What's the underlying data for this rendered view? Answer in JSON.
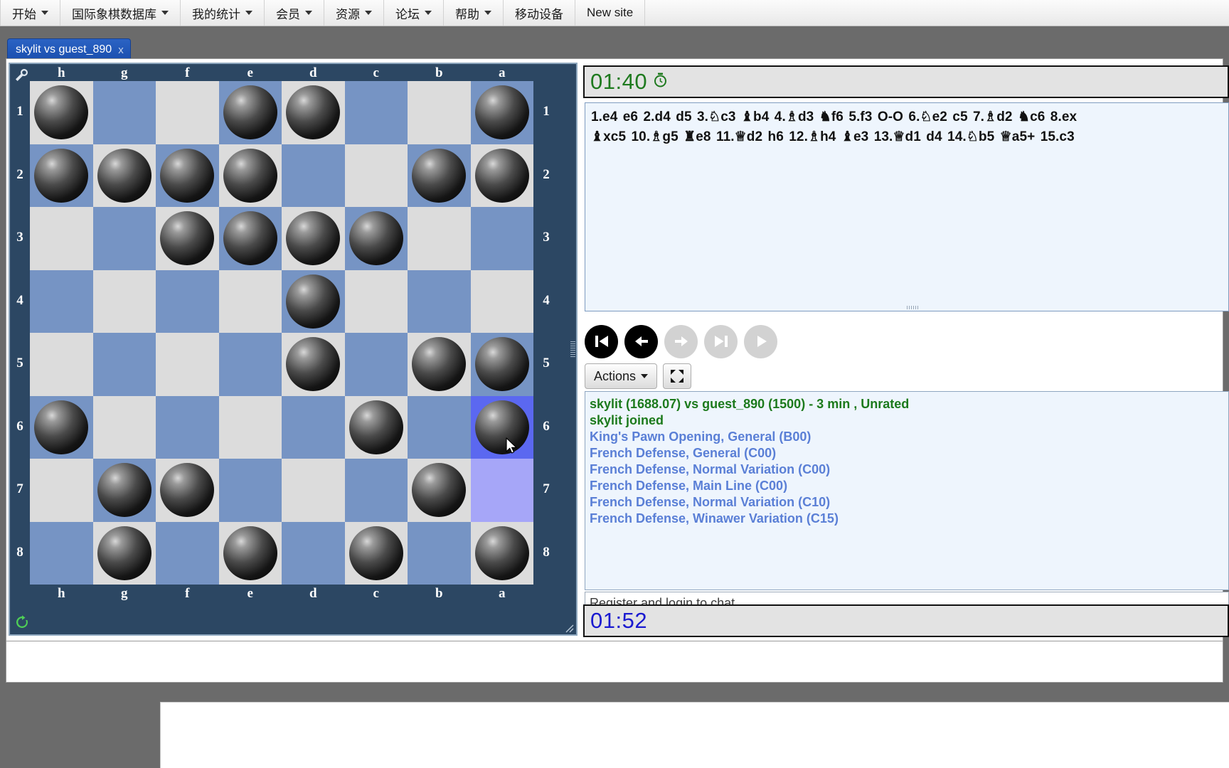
{
  "menubar": {
    "items": [
      {
        "label": "开始",
        "caret": true
      },
      {
        "label": "国际象棋数据库",
        "caret": true
      },
      {
        "label": "我的统计",
        "caret": true
      },
      {
        "label": "会员",
        "caret": true
      },
      {
        "label": "资源",
        "caret": true
      },
      {
        "label": "论坛",
        "caret": true
      },
      {
        "label": "帮助",
        "caret": true
      },
      {
        "label": "移动设备",
        "caret": false
      },
      {
        "label": "New site",
        "caret": false
      }
    ]
  },
  "tab": {
    "label": "skylit vs guest_890",
    "close": "x"
  },
  "board": {
    "files_top": [
      "h",
      "g",
      "f",
      "e",
      "d",
      "c",
      "b",
      "a"
    ],
    "files_bottom": [
      "h",
      "g",
      "f",
      "e",
      "d",
      "c",
      "b",
      "a"
    ],
    "ranks_left": [
      "1",
      "2",
      "3",
      "4",
      "5",
      "6",
      "7",
      "8"
    ],
    "ranks_right": [
      "1",
      "2",
      "3",
      "4",
      "5",
      "6",
      "7",
      "8"
    ],
    "tool_icon": "wrench-icon",
    "refresh_icon": "refresh-icon",
    "resize_icon": "resize-grip-icon",
    "highlight_from": "a7",
    "highlight_to": "a6",
    "orientation": "black-bottom-flipped",
    "piece_rows": [
      [
        1,
        0,
        0,
        1,
        1,
        0,
        0,
        1
      ],
      [
        1,
        1,
        1,
        1,
        0,
        0,
        1,
        1
      ],
      [
        0,
        0,
        1,
        1,
        1,
        1,
        0,
        0
      ],
      [
        0,
        0,
        0,
        0,
        1,
        0,
        0,
        0
      ],
      [
        0,
        0,
        0,
        0,
        1,
        0,
        1,
        1
      ],
      [
        1,
        0,
        0,
        0,
        0,
        1,
        0,
        1
      ],
      [
        0,
        1,
        1,
        0,
        0,
        0,
        1,
        0
      ],
      [
        0,
        1,
        0,
        1,
        0,
        1,
        0,
        1
      ]
    ]
  },
  "clocks": {
    "top": {
      "time": "01:40",
      "icon": "stopwatch-icon",
      "color": "#1f7a1f"
    },
    "bottom": {
      "time": "01:52",
      "icon": "none",
      "color": "#1a1ad0"
    }
  },
  "moves": {
    "text": "1.e4 e6 2.d4 d5 3.♘c3 ♝b4 4.♗d3 ♞f6 5.f3 O-O 6.♘e2 c5 7.♗d2 ♞c6 8.ex ♝xc5 10.♗g5 ♜e8 11.♕d2 h6 12.♗h4 ♝e3 13.♕d1 d4 14.♘b5 ♕a5+ 15.c3",
    "line1": "1.e4 e6 2.d4 d5 3.♘c3 ♝b4 4.♗d3 ♞f6 5.f3 O-O 6.♘e2 c5 7.♗d2 ♞c6 8.ex",
    "line2": "♝xc5 10.♗g5 ♜e8 11.♕d2 h6 12.♗h4 ♝e3 13.♕d1 d4 14.♘b5 ♕a5+ 15.c3"
  },
  "nav": {
    "first": {
      "icon": "skip-to-start-icon",
      "enabled": true
    },
    "prev": {
      "icon": "step-backward-icon",
      "enabled": true
    },
    "next": {
      "icon": "step-forward-icon",
      "enabled": false
    },
    "last": {
      "icon": "skip-to-end-icon",
      "enabled": false
    },
    "play": {
      "icon": "play-icon",
      "enabled": false
    }
  },
  "toolbar": {
    "actions_label": "Actions",
    "expand_icon": "fullscreen-icon"
  },
  "chat": {
    "lines": [
      {
        "text": "skylit (1688.07) vs guest_890 (1500) - 3 min , Unrated",
        "kind": "sys"
      },
      {
        "text": "skylit joined",
        "kind": "sys"
      },
      {
        "text": "King's Pawn Opening, General (B00)",
        "kind": "open"
      },
      {
        "text": "French Defense, General (C00)",
        "kind": "open"
      },
      {
        "text": "French Defense, Normal Variation (C00)",
        "kind": "open"
      },
      {
        "text": "French Defense, Main Line (C00)",
        "kind": "open"
      },
      {
        "text": "French Defense, Normal Variation (C10)",
        "kind": "open"
      },
      {
        "text": "French Defense, Winawer Variation (C15)",
        "kind": "open"
      }
    ],
    "input_text": "Register and login to chat"
  }
}
